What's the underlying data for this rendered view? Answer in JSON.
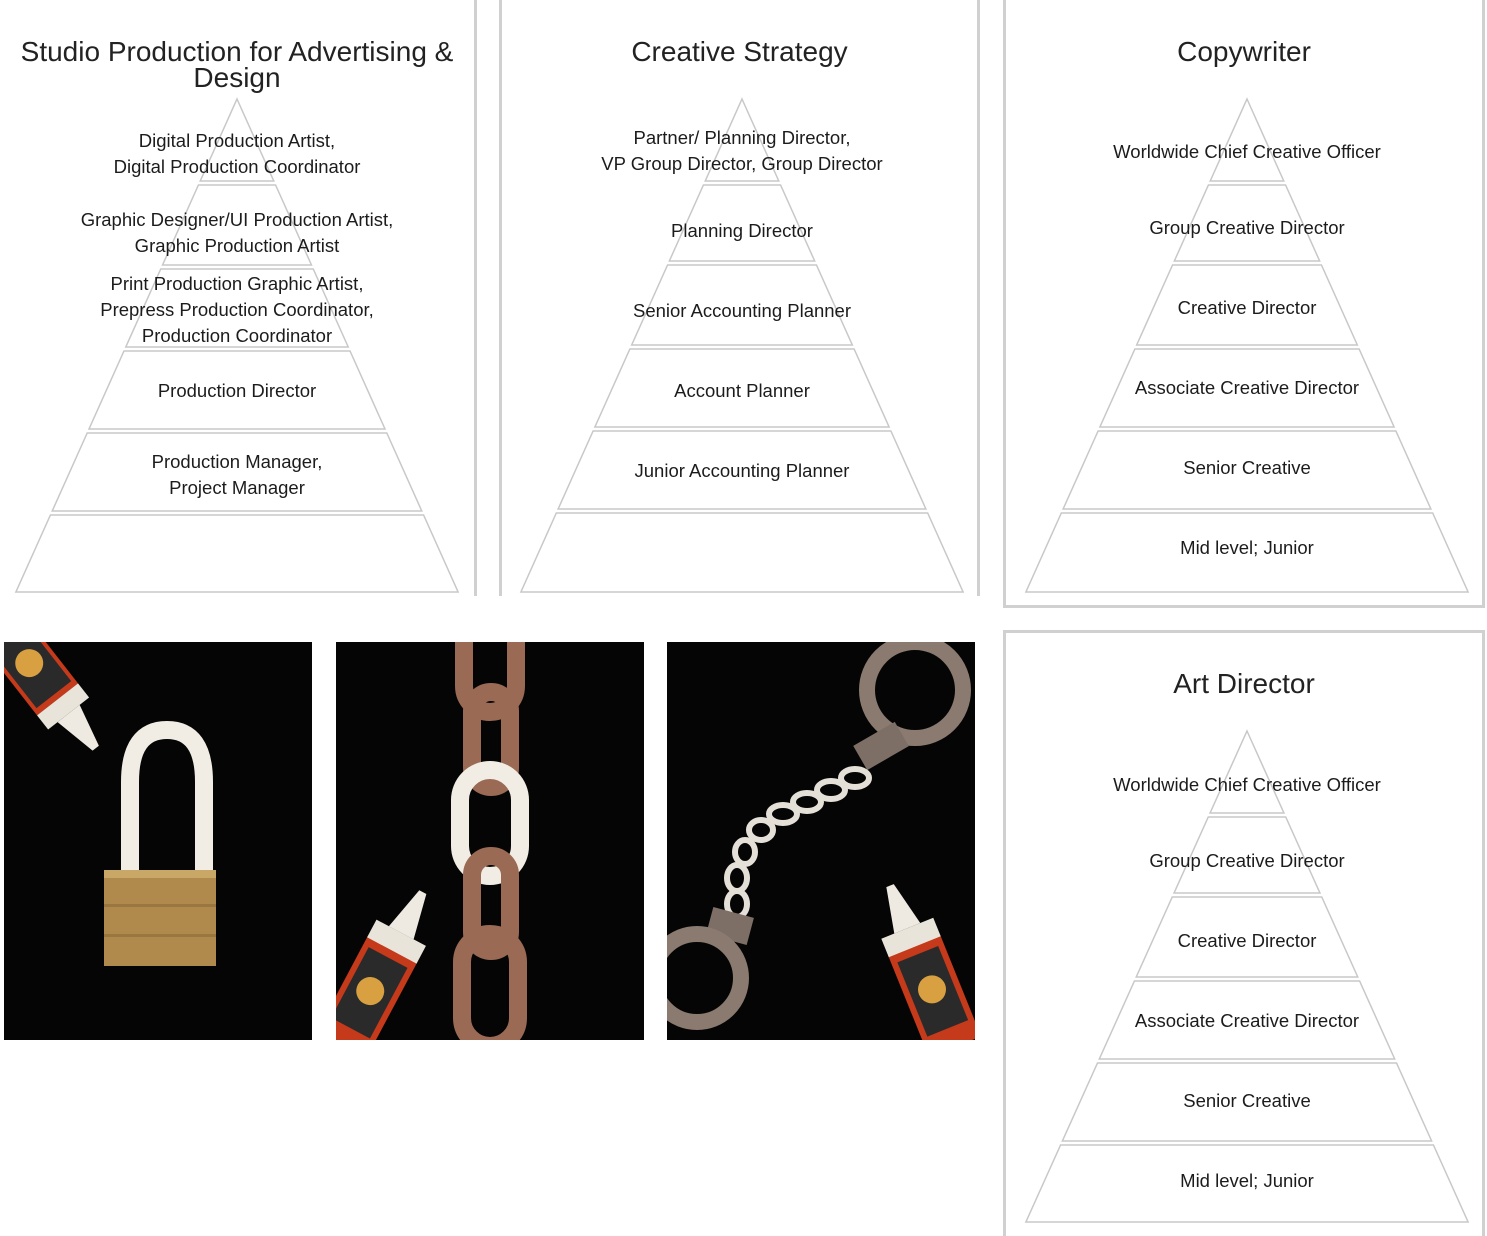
{
  "pyramids": [
    {
      "id": "studio",
      "title": "Studio Production for Advertising & Design",
      "levels": [
        [
          "Digital Production Artist,",
          "Digital Production Coordinator"
        ],
        [
          "Graphic Designer/UI Production Artist,",
          "Graphic Production Artist"
        ],
        [
          "Print Production Graphic Artist,",
          "Prepress Production Coordinator,",
          "Production Coordinator"
        ],
        [
          "Production Director"
        ],
        [
          "Production Manager,",
          "Project Manager"
        ],
        []
      ]
    },
    {
      "id": "strategy",
      "title": "Creative Strategy",
      "levels": [
        [
          "Partner/ Planning Director,",
          "VP Group Director, Group Director"
        ],
        [
          "Planning Director"
        ],
        [
          "Senior Accounting Planner"
        ],
        [
          "Account Planner"
        ],
        [
          "Junior Accounting Planner"
        ],
        []
      ]
    },
    {
      "id": "copywriter",
      "title": "Copywriter",
      "levels": [
        [
          "Worldwide Chief Creative Officer"
        ],
        [
          "Group Creative Director"
        ],
        [
          "Creative Director"
        ],
        [
          "Associate Creative Director"
        ],
        [
          "Senior Creative"
        ],
        [
          "Mid level; Junior"
        ]
      ]
    },
    {
      "id": "art",
      "title": "Art Director",
      "levels": [
        [
          "Worldwide Chief Creative Officer"
        ],
        [
          "Group Creative Director"
        ],
        [
          "Creative Director"
        ],
        [
          "Associate Creative Director"
        ],
        [
          "Senior Creative"
        ],
        [
          "Mid level; Junior"
        ]
      ]
    }
  ],
  "photos": [
    {
      "id": "lock",
      "subject": "padlock-with-glue-shackle"
    },
    {
      "id": "chain",
      "subject": "chain-with-glue-link"
    },
    {
      "id": "cuffs",
      "subject": "handcuffs-with-glue-chain"
    }
  ],
  "colors": {
    "border": "#d0d0d0",
    "pyramid_stroke": "#c8c8c8",
    "photo_bg": "#050505",
    "metal_copper": "#9a6a55",
    "glue_white": "#f1ede4",
    "brass": "#b08a4c"
  }
}
